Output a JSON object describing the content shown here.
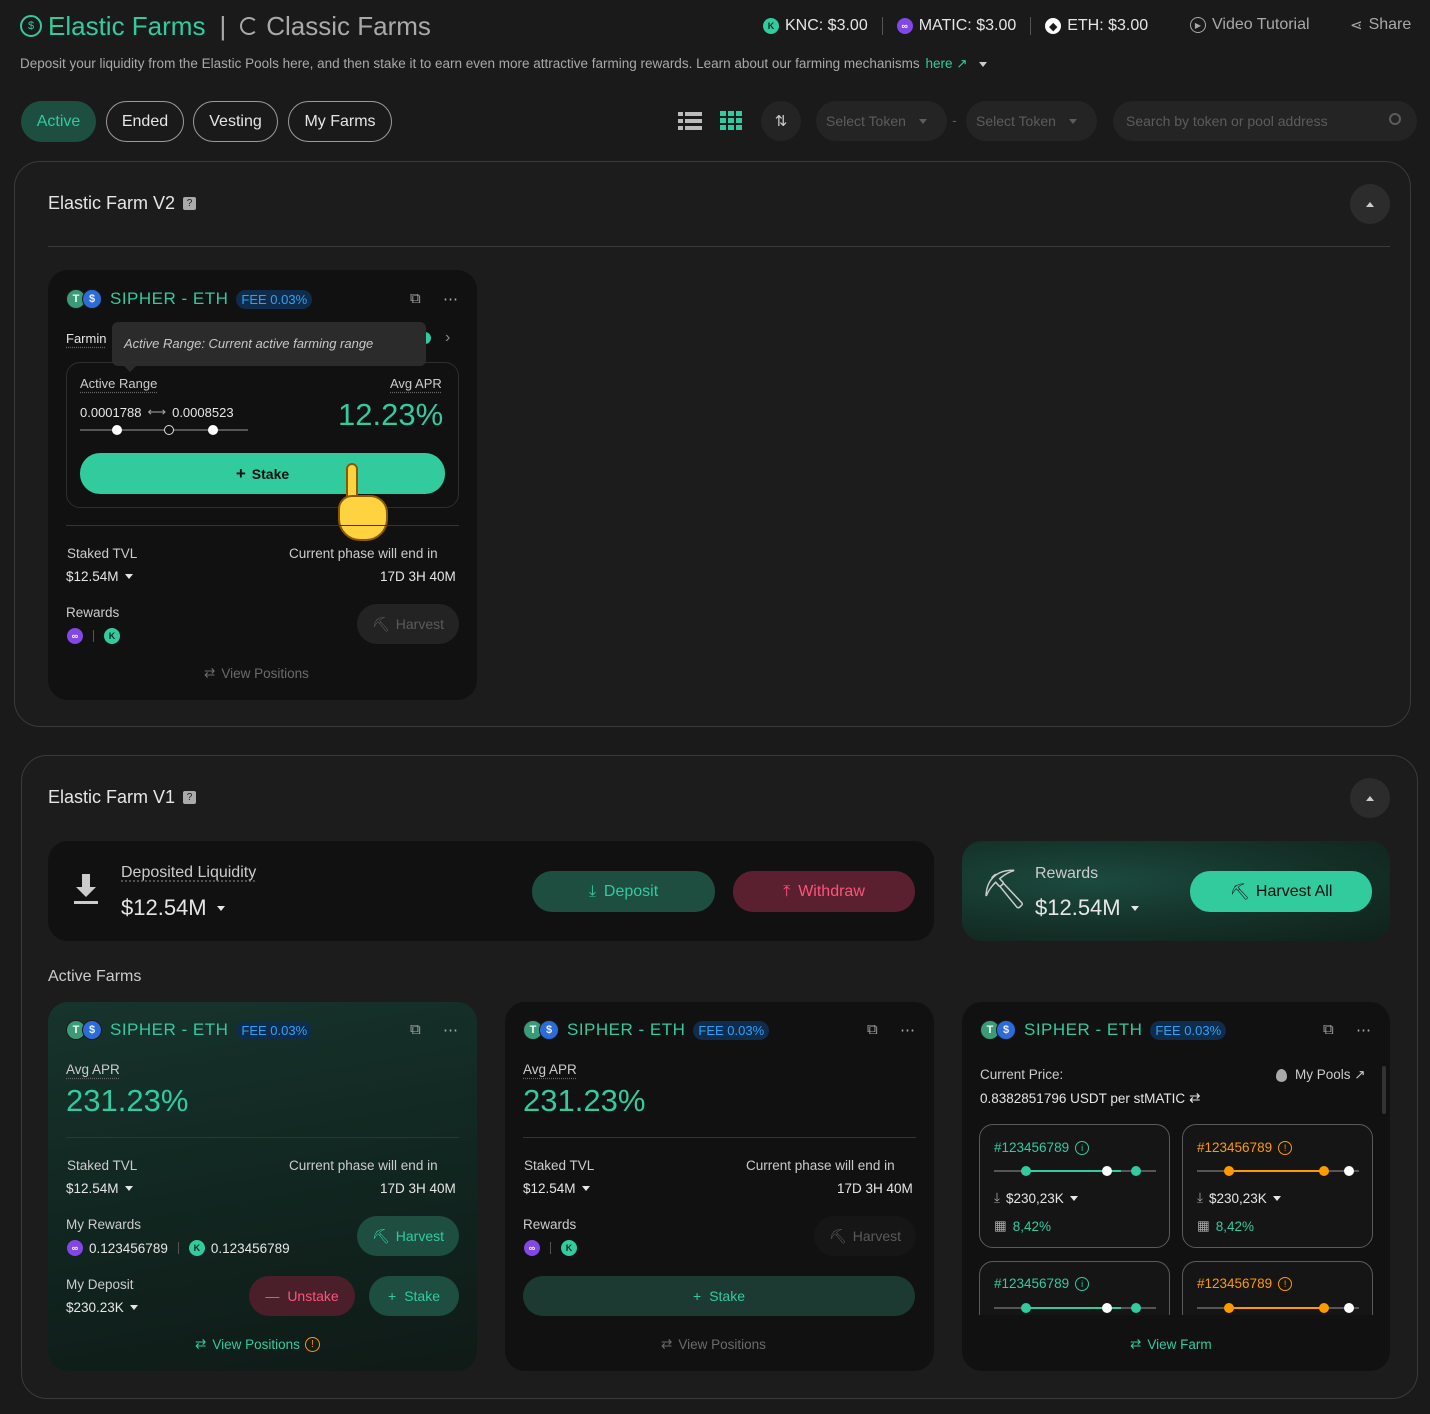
{
  "header": {
    "elastic_title": "Elastic Farms",
    "separator": "|",
    "classic_title": "Classic Farms",
    "prices": [
      {
        "label": "KNC: $3.00",
        "icon": "knc-icon"
      },
      {
        "label": "MATIC: $3.00",
        "icon": "matic-icon"
      },
      {
        "label": "ETH: $3.00",
        "icon": "eth-icon"
      }
    ],
    "video_tutorial": "Video Tutorial",
    "share": "Share",
    "description": "Deposit your liquidity from the Elastic Pools here, and then stake it to earn even more attractive farming rewards. Learn about our farming mechanisms",
    "here_link": "here ↗"
  },
  "filters": {
    "tabs": [
      "Active",
      "Ended",
      "Vesting",
      "My Farms"
    ],
    "select_token_1": "Select Token",
    "dash": "-",
    "select_token_2": "Select Token",
    "search_placeholder": "Search by token or pool address"
  },
  "farm_v2": {
    "title": "Elastic Farm V2",
    "card": {
      "pair": "SIPHER - ETH",
      "fee": "FEE 0.03%",
      "farming_label": "Farmin",
      "tooltip": "Active Range: Current active farming range",
      "active_range_label": "Active Range",
      "range_min": "0.0001788",
      "range_arrow": "⟷",
      "range_max": "0.0008523",
      "avg_apr_label": "Avg APR",
      "avg_apr": "12.23%",
      "stake_label": "Stake",
      "staked_tvl_label": "Staked TVL",
      "staked_tvl": "$12.54M",
      "phase_label": "Current phase will end in",
      "phase_value": "17D 3H 40M",
      "rewards_label": "Rewards",
      "harvest_label": "Harvest",
      "view_positions": "View Positions"
    }
  },
  "farm_v1": {
    "title": "Elastic Farm V1",
    "deposited_label": "Deposited Liquidity",
    "deposited_value": "$12.54M",
    "deposit_btn": "Deposit",
    "withdraw_btn": "Withdraw",
    "rewards_label": "Rewards",
    "rewards_value": "$12.54M",
    "harvest_all": "Harvest All",
    "active_farms_label": "Active Farms",
    "card1": {
      "pair": "SIPHER - ETH",
      "fee": "FEE 0.03%",
      "avg_apr_label": "Avg APR",
      "avg_apr": "231.23%",
      "staked_tvl_label": "Staked TVL",
      "staked_tvl": "$12.54M",
      "phase_label": "Current phase will end in",
      "phase_value": "17D 3H 40M",
      "my_rewards_label": "My Rewards",
      "reward_1": "0.123456789",
      "reward_2": "0.123456789",
      "harvest_label": "Harvest",
      "my_deposit_label": "My Deposit",
      "my_deposit": "$230.23K",
      "unstake_label": "Unstake",
      "stake_label": "Stake",
      "view_positions": "View Positions"
    },
    "card2": {
      "pair": "SIPHER - ETH",
      "fee": "FEE 0.03%",
      "avg_apr_label": "Avg APR",
      "avg_apr": "231.23%",
      "staked_tvl_label": "Staked TVL",
      "staked_tvl": "$12.54M",
      "phase_label": "Current phase will end in",
      "phase_value": "17D 3H 40M",
      "rewards_label": "Rewards",
      "harvest_label": "Harvest",
      "stake_label": "Stake",
      "view_positions": "View Positions"
    },
    "card3": {
      "pair": "SIPHER - ETH",
      "fee": "FEE 0.03%",
      "current_price_label": "Current Price:",
      "my_pools": "My Pools ↗",
      "price_value": "0.8382851796 USDT per stMATIC",
      "positions": [
        {
          "id": "#123456789",
          "value": "$230,23K",
          "apr": "8,42%",
          "status_color": "#31cb9e"
        },
        {
          "id": "#123456789",
          "value": "$230,23K",
          "apr": "8,42%",
          "status_color": "#ff9901"
        },
        {
          "id": "#123456789",
          "status_color": "#31cb9e"
        },
        {
          "id": "#123456789",
          "status_color": "#ff9901"
        }
      ],
      "view_farm": "View Farm"
    }
  },
  "colors": {
    "accent": "#31cb9e",
    "warning": "#ff9901",
    "danger": "#ff537b",
    "info": "#33a1f0"
  }
}
